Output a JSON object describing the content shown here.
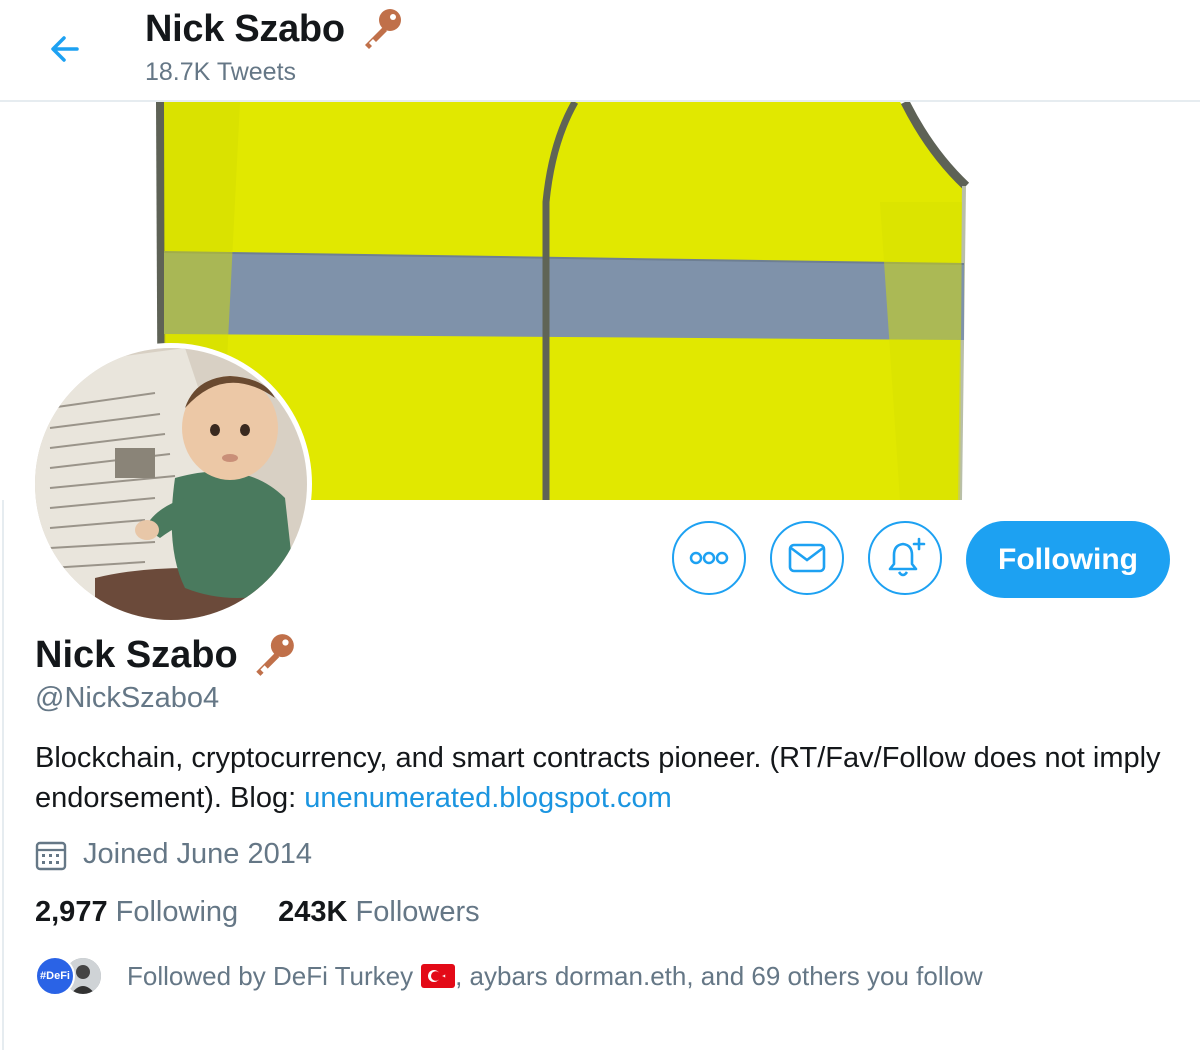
{
  "header": {
    "name": "Nick Szabo",
    "tweet_count": "18.7K Tweets"
  },
  "actions": {
    "following_label": "Following"
  },
  "profile": {
    "name": "Nick Szabo",
    "handle": "@NickSzabo4",
    "bio_text": "Blockchain, cryptocurrency, and smart contracts pioneer. (RT/Fav/Follow does not imply endorsement). Blog: ",
    "bio_link": "unenumerated.blogspot.com",
    "joined": "Joined June 2014",
    "following_count": "2,977",
    "following_label": "Following",
    "followers_count": "243K",
    "followers_label": "Followers",
    "followed_by_prefix": "Followed by DeFi Turkey",
    "followed_by_suffix": ", aybars dorman.eth, and 69 others you follow",
    "defi_badge": "#DeFi"
  },
  "icons": {
    "back": "arrow-left-icon",
    "key": "key-emoji-icon",
    "more": "more-dots-icon",
    "message": "envelope-icon",
    "notify": "bell-plus-icon",
    "calendar": "calendar-icon",
    "flag": "turkey-flag-icon"
  },
  "colors": {
    "accent": "#1da1f2",
    "link": "#1b95e0",
    "muted": "#657786",
    "vest_yellow": "#e1e800",
    "key_copper": "#c0704a"
  }
}
